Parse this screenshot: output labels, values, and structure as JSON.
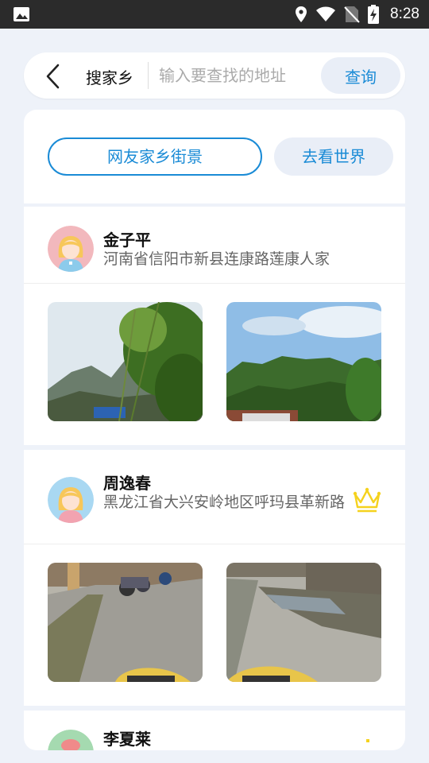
{
  "statusbar": {
    "time": "8:28",
    "icons": [
      "image-icon",
      "location-icon",
      "wifi-icon",
      "no-sim-icon",
      "battery-charging-icon"
    ]
  },
  "search": {
    "title": "搜家乡",
    "placeholder": "输入要查找的地址",
    "query_label": "查询"
  },
  "tabs": [
    {
      "label": "网友家乡街景",
      "active": true
    },
    {
      "label": "去看世界",
      "active": false
    }
  ],
  "users": [
    {
      "name": "金子平",
      "address": "河南省信阳市新县连康路莲康人家",
      "avatar_color": "#f2b8bd",
      "crown": false,
      "photos": [
        "mountain-bamboo-street-view",
        "hill-forest-street-view"
      ]
    },
    {
      "name": "周逸春",
      "address": "黑龙江省大兴安岭地区呼玛县革新路",
      "avatar_color": "#a9d8f2",
      "crown": true,
      "photos": [
        "village-road-motorcycles-street-view",
        "village-road-puddle-street-view"
      ]
    },
    {
      "name": "李夏莱",
      "avatar_color": "#a5dab0",
      "crown": true
    }
  ],
  "colors": {
    "accent": "#1a8bd6",
    "background": "#eef2f9",
    "crown": "#f5d21e"
  }
}
